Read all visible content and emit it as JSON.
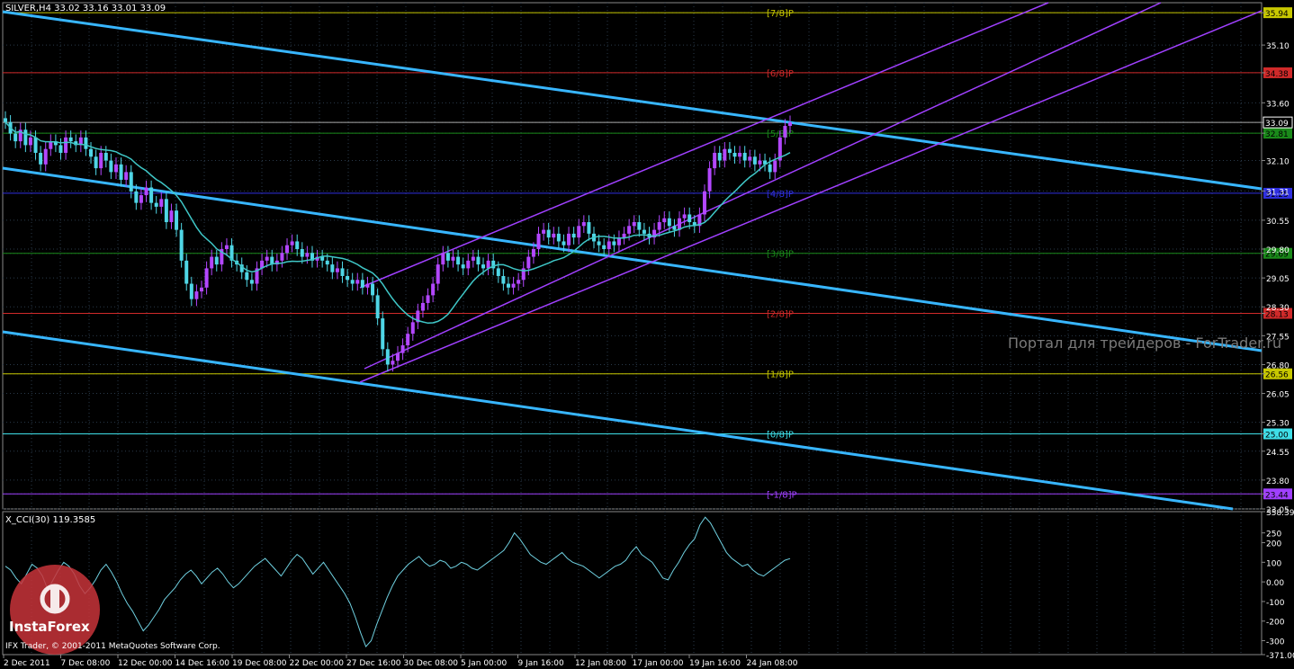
{
  "header": {
    "symbol_info": "SILVER,H4  33.02 33.16 33.01 33.09"
  },
  "indicator": {
    "title": "X_CCI(30) 119.3585"
  },
  "footer": {
    "copyright": "IFX Trader, © 2001-2011 MetaQuotes Software Corp."
  },
  "watermark": "Портал для трейдеров - ForTrader.ru",
  "logo": {
    "text": "InstaForex"
  },
  "colors": {
    "background": "#000000",
    "grid": "#2a3a4a",
    "bull": "#b347ff",
    "bear": "#4fd6e6",
    "ma": "#3fc7c7",
    "channel_blue": "#38b6ff",
    "channel_purple": "#a040ff",
    "cci": "#6fd0e0"
  },
  "chart_data": {
    "type": "candlestick",
    "price_axis": {
      "ticks": [
        "35.94",
        "35.10",
        "34.38",
        "33.60",
        "33.09",
        "32.81",
        "32.10",
        "31.31",
        "30.55",
        "29.80",
        "29.69",
        "29.05",
        "28.30",
        "28.13",
        "27.55",
        "26.80",
        "26.56",
        "26.05",
        "25.30",
        "25.00",
        "24.55",
        "23.80",
        "23.44",
        "23.05"
      ],
      "ylim": [
        23.05,
        36.2
      ]
    },
    "murrey_levels": [
      {
        "label": "[7/8]P",
        "price": 35.94,
        "tag": "35.94",
        "color": "#c8c800"
      },
      {
        "label": "[6/8]P",
        "price": 34.38,
        "tag": "34.38",
        "color": "#d02a2a"
      },
      {
        "label": "[5/8]P",
        "price": 32.81,
        "tag": "32.81",
        "color": "#1a8a1a"
      },
      {
        "label": "[4/8]P",
        "price": 31.25,
        "tag": "31.25",
        "color": "#3030e0"
      },
      {
        "label": "[3/8]P",
        "price": 29.69,
        "tag": "29.69",
        "color": "#1a8a1a"
      },
      {
        "label": "[2/8]P",
        "price": 28.13,
        "tag": "28.13",
        "color": "#d02a2a"
      },
      {
        "label": "[1/8]P",
        "price": 26.56,
        "tag": "26.56",
        "color": "#c8c800"
      },
      {
        "label": "[0/8]P",
        "price": 25.0,
        "tag": "25.00",
        "color": "#3fdfe8"
      },
      {
        "label": "[-1/8]P",
        "price": 23.44,
        "tag": "23.44",
        "color": "#a040ff"
      }
    ],
    "current_price": {
      "value": 33.09,
      "tag": "33.09"
    },
    "time_labels": [
      "2 Dec 2011",
      "7 Dec 08:00",
      "12 Dec 00:00",
      "14 Dec 16:00",
      "19 Dec 08:00",
      "22 Dec 00:00",
      "27 Dec 16:00",
      "30 Dec 08:00",
      "5 Jan 00:00",
      "9 Jan 16:00",
      "12 Jan 08:00",
      "17 Jan 00:00",
      "19 Jan 16:00",
      "24 Jan 08:00"
    ],
    "closes": [
      33.1,
      32.8,
      32.6,
      32.9,
      32.5,
      32.7,
      32.3,
      32.0,
      32.4,
      32.6,
      32.5,
      32.3,
      32.7,
      32.6,
      32.5,
      32.7,
      32.4,
      32.2,
      31.9,
      32.3,
      32.1,
      31.8,
      32.0,
      31.6,
      31.8,
      31.3,
      31.0,
      31.2,
      31.4,
      31.0,
      30.9,
      31.1,
      30.5,
      30.8,
      30.3,
      29.5,
      28.9,
      28.5,
      28.7,
      28.8,
      29.3,
      29.6,
      29.4,
      29.8,
      29.9,
      29.5,
      29.4,
      29.2,
      29.0,
      28.9,
      29.3,
      29.5,
      29.6,
      29.4,
      29.5,
      29.7,
      29.9,
      30.0,
      29.8,
      29.6,
      29.7,
      29.5,
      29.6,
      29.5,
      29.4,
      29.2,
      29.3,
      29.1,
      29.0,
      28.9,
      29.0,
      28.8,
      28.9,
      28.6,
      28.0,
      27.2,
      26.8,
      26.9,
      27.1,
      27.3,
      27.6,
      27.9,
      28.2,
      28.4,
      28.6,
      28.9,
      29.4,
      29.7,
      29.5,
      29.6,
      29.4,
      29.3,
      29.5,
      29.6,
      29.4,
      29.3,
      29.5,
      29.3,
      29.1,
      28.9,
      28.8,
      28.9,
      29.0,
      29.3,
      29.6,
      29.8,
      30.2,
      30.3,
      30.1,
      30.2,
      30.0,
      29.9,
      30.2,
      30.1,
      30.4,
      30.5,
      30.2,
      30.0,
      29.9,
      29.8,
      30.0,
      29.9,
      30.1,
      30.2,
      30.4,
      30.5,
      30.3,
      30.2,
      30.1,
      30.3,
      30.5,
      30.6,
      30.4,
      30.3,
      30.6,
      30.7,
      30.5,
      30.4,
      30.7,
      31.3,
      31.9,
      32.3,
      32.1,
      32.4,
      32.3,
      32.2,
      32.3,
      32.1,
      32.2,
      32.0,
      32.1,
      32.0,
      31.8,
      32.1,
      32.7,
      33.0,
      33.09
    ]
  },
  "cci": {
    "ticks": [
      "358.395",
      "250",
      "200",
      "100",
      "0.00",
      "-100",
      "-200",
      "-300",
      "-371.007"
    ],
    "ylim": [
      -371.007,
      358.395
    ],
    "values": [
      80,
      60,
      20,
      -10,
      40,
      90,
      70,
      30,
      -40,
      10,
      60,
      100,
      80,
      40,
      -20,
      -60,
      -30,
      10,
      60,
      90,
      50,
      0,
      -60,
      -110,
      -150,
      -200,
      -250,
      -220,
      -180,
      -140,
      -90,
      -60,
      -30,
      10,
      40,
      60,
      30,
      -10,
      20,
      50,
      70,
      40,
      0,
      -30,
      -10,
      20,
      50,
      80,
      100,
      120,
      90,
      60,
      30,
      70,
      110,
      140,
      120,
      80,
      40,
      70,
      100,
      60,
      20,
      -20,
      -60,
      -110,
      -180,
      -260,
      -330,
      -300,
      -220,
      -150,
      -80,
      -20,
      30,
      60,
      90,
      110,
      130,
      100,
      80,
      90,
      110,
      100,
      70,
      80,
      100,
      90,
      70,
      60,
      80,
      100,
      120,
      140,
      160,
      200,
      250,
      220,
      180,
      140,
      120,
      100,
      90,
      110,
      130,
      150,
      120,
      100,
      90,
      80,
      60,
      40,
      20,
      40,
      60,
      80,
      90,
      110,
      150,
      180,
      140,
      120,
      100,
      60,
      20,
      10,
      60,
      100,
      150,
      190,
      220,
      290,
      330,
      300,
      250,
      200,
      150,
      120,
      100,
      80,
      90,
      60,
      40,
      30,
      50,
      70,
      90,
      110,
      119
    ]
  }
}
